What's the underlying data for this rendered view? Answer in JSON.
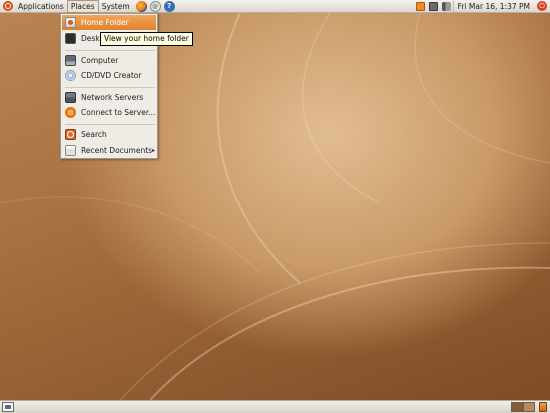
{
  "top_panel": {
    "menus": {
      "applications": "Applications",
      "places": "Places",
      "system": "System"
    },
    "launchers": [
      "firefox-icon",
      "mail-icon",
      "help-icon"
    ],
    "help_glyph": "?",
    "clock": "Fri Mar 16,  1:37 PM",
    "tray": [
      "update-notifier-icon",
      "network-icon",
      "volume-icon"
    ],
    "power_glyph": "⏻"
  },
  "places_menu": {
    "items": [
      {
        "label": "Home Folder",
        "icon": "home-folder-icon",
        "highlighted": true
      },
      {
        "label": "Desktop",
        "icon": "desktop-icon"
      },
      {
        "label": "Computer",
        "icon": "computer-icon"
      },
      {
        "label": "CD/DVD Creator",
        "icon": "cd-dvd-icon"
      },
      {
        "label": "Network Servers",
        "icon": "network-servers-icon"
      },
      {
        "label": "Connect to Server...",
        "icon": "connect-server-icon"
      },
      {
        "label": "Search",
        "icon": "search-icon"
      },
      {
        "label": "Recent Documents",
        "icon": "recent-documents-icon",
        "submenu_arrow": "▸"
      }
    ]
  },
  "tooltip": {
    "text": "View your home folder"
  },
  "bottom_panel": {
    "workspaces": 2,
    "active_workspace": 1
  },
  "colors": {
    "panel": "#e8e4de",
    "menu_highlight": "#e98f3c",
    "ubuntu_orange": "#dd4814",
    "wallpaper_light": "#e2bd92",
    "wallpaper_dark": "#7d4c25",
    "tooltip_bg": "#ffffe1"
  }
}
